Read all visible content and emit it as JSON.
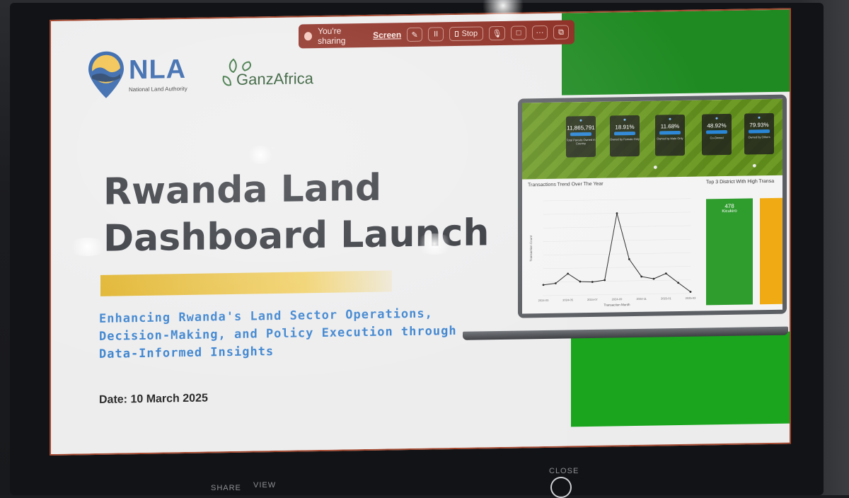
{
  "sharebar": {
    "status_text": "You're sharing",
    "source_link": "Screen",
    "pause_label": "II",
    "stop_label": "Stop",
    "more_label": "···"
  },
  "logos": {
    "nla_name": "NLA",
    "nla_subtitle": "National Land Authority",
    "partner_name": "GanzAfrica"
  },
  "slide": {
    "title_line1": "Rwanda Land",
    "title_line2": "Dashboard Launch",
    "subtitle": "Enhancing Rwanda's Land Sector Operations, Decision-Making, and Policy Execution through Data-Informed Insights",
    "date": "Date: 10 March 2025"
  },
  "dashboard_preview": {
    "kpis": [
      {
        "value": "11,865,791",
        "caption": "Total Parcels Owned in Country"
      },
      {
        "value": "18.91%",
        "caption": "Owned by Female Only"
      },
      {
        "value": "11.68%",
        "caption": "Owned by Male Only"
      },
      {
        "value": "48.92%",
        "caption": "Co-Owned"
      },
      {
        "value": "79.93%",
        "caption": "Owned by Others"
      }
    ],
    "trend_title": "Transactions Trend Over The Year",
    "top_title": "Top 3 District With High Transa",
    "top_value": "478",
    "top_label": "Kicukiro",
    "x_label": "Transaction Month",
    "y_label": "Transaction Count"
  },
  "chart_data": {
    "type": "line",
    "title": "Transactions Trend Over The Year",
    "xlabel": "Transaction Month",
    "ylabel": "Transaction Count",
    "x": [
      "2024-03",
      "2024-04",
      "2024-05",
      "2024-06",
      "2024-07",
      "2024-08",
      "2024-09",
      "2024-10",
      "2024-11",
      "2024-12",
      "2025-01",
      "2025-02",
      "2025-03"
    ],
    "values": [
      400,
      450,
      800,
      500,
      480,
      540,
      3000,
      1300,
      650,
      560,
      750,
      400,
      60
    ],
    "ylim": [
      0,
      3500
    ],
    "colors": {
      "line": "#2b2b2b"
    }
  },
  "controls": {
    "share_label": "SHARE",
    "view_label": "VIEW",
    "close_label": "CLOSE"
  },
  "colors": {
    "accent_blue": "#3b83cf",
    "brand_green": "#1f8a22",
    "gold": "#e0b32a",
    "share_bar": "#8b2a1f"
  }
}
